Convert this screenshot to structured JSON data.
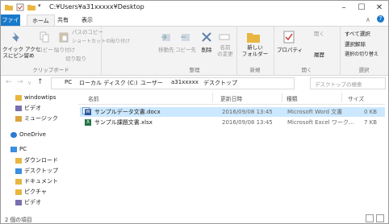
{
  "title": "C:¥Users¥a31xxxxx¥Desktop",
  "window_controls": {
    "minimize": "–",
    "maximize": "☐",
    "close": "✕"
  },
  "tabs": {
    "file": "ファイル",
    "home": "ホーム",
    "share": "共有",
    "view": "表示"
  },
  "ribbon": {
    "quick_access_pin": "クイック アクセ\nスにピン留め",
    "copy": "コピー",
    "paste": "貼り付け",
    "path_copy": "パスのコピー",
    "shortcut_paste": "ショートカットの貼り付け",
    "cut": "切り取り",
    "clipboard_group": "クリップボード",
    "move_to": "移動先",
    "copy_to": "コピー先",
    "delete": "削除",
    "rename": "名前\nの変更",
    "organize_group": "整理",
    "new_folder": "新しい\nフォルダー",
    "new_group": "新規",
    "properties": "プロパティ",
    "open_small": "開く",
    "history": "履歴",
    "open_group": "開く",
    "select_all": "すべて選択",
    "select_none": "選択解除",
    "invert_selection": "選択の切り替え",
    "select_group": "選択"
  },
  "address": {
    "breadcrumbs": [
      "PC",
      "ローカル ディスク (C:)",
      "ユーザー",
      "a31xxxxx",
      "デスクトップ"
    ],
    "search_placeholder": "デスクトップの検索"
  },
  "nav": {
    "items": [
      {
        "label": "windowtips",
        "icon": "folder"
      },
      {
        "label": "ビデオ",
        "icon": "video-folder"
      },
      {
        "label": "ミュージック",
        "icon": "music-folder"
      },
      {
        "label": "OneDrive",
        "icon": "cloud"
      },
      {
        "label": "PC",
        "icon": "computer"
      },
      {
        "label": "ダウンロード",
        "icon": "download-folder"
      },
      {
        "label": "デスクトップ",
        "icon": "desktop-folder"
      },
      {
        "label": "ドキュメント",
        "icon": "documents-folder"
      },
      {
        "label": "ピクチャ",
        "icon": "pictures-folder"
      },
      {
        "label": "ビデオ",
        "icon": "video-folder"
      }
    ]
  },
  "columns": {
    "name": "名前",
    "modified": "更新日時",
    "type": "種類",
    "size": "サイズ"
  },
  "files": [
    {
      "name": "サンプルデータ文書.docx",
      "modified": "2016/09/08 13:45",
      "type": "Microsoft Word 文書",
      "size": "0 KB",
      "icon": "word"
    },
    {
      "name": "サンプル課題文書.xlsx",
      "modified": "2016/09/08 13:45",
      "type": "Microsoft Excel ワーク...",
      "size": "7 KB",
      "icon": "excel"
    }
  ],
  "status": {
    "count": "2 個の項目"
  },
  "colors": {
    "accent": "#1979ca",
    "selection": "#cce8ff",
    "word": "#2b579a",
    "excel": "#217346",
    "folder": "#e8b640"
  }
}
